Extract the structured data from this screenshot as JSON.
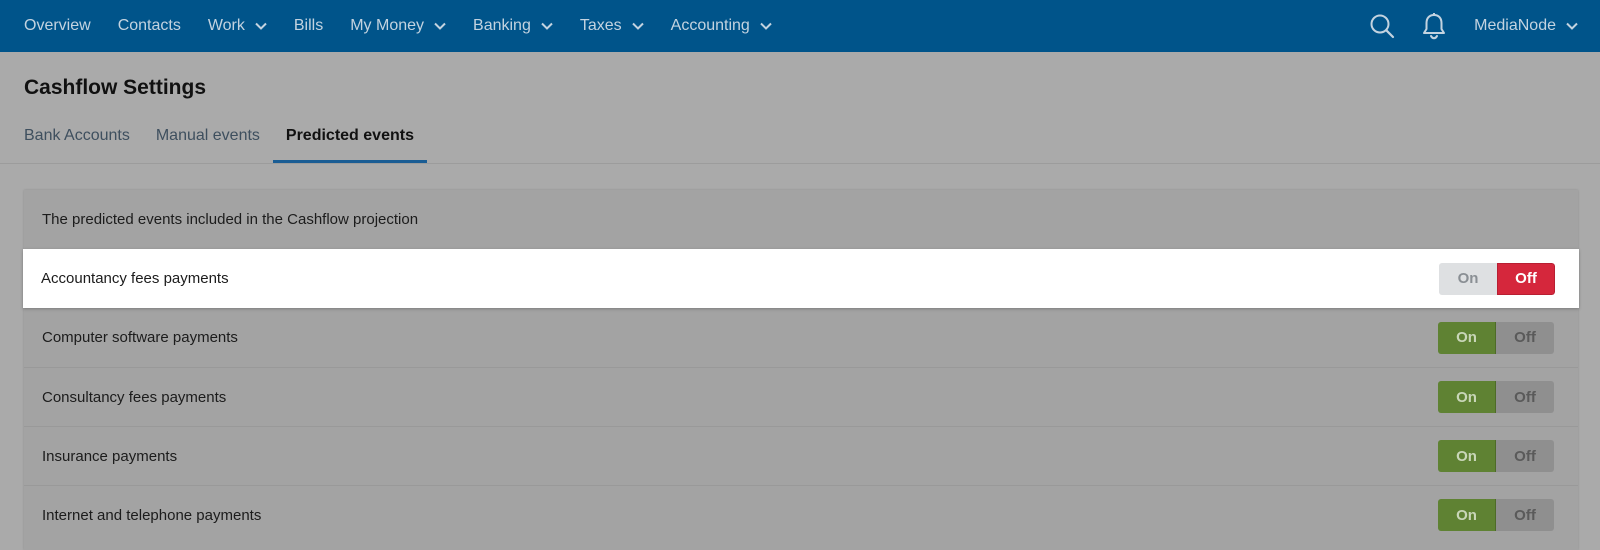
{
  "nav": {
    "items": [
      {
        "label": "Overview",
        "dropdown": false
      },
      {
        "label": "Contacts",
        "dropdown": false
      },
      {
        "label": "Work",
        "dropdown": true
      },
      {
        "label": "Bills",
        "dropdown": false
      },
      {
        "label": "My Money",
        "dropdown": true
      },
      {
        "label": "Banking",
        "dropdown": true
      },
      {
        "label": "Taxes",
        "dropdown": true
      },
      {
        "label": "Accounting",
        "dropdown": true
      }
    ],
    "account_label": "MediaNode",
    "icons": {
      "search": "search-icon",
      "notifications": "bell-icon"
    }
  },
  "page": {
    "title": "Cashflow Settings",
    "tabs": [
      {
        "label": "Bank Accounts",
        "active": false
      },
      {
        "label": "Manual events",
        "active": false
      },
      {
        "label": "Predicted events",
        "active": true
      }
    ]
  },
  "panel": {
    "header": "The predicted events included in the Cashflow projection",
    "toggle_labels": {
      "on": "On",
      "off": "Off"
    },
    "rows": [
      {
        "label": "Accountancy fees payments",
        "state": "off",
        "highlighted": true
      },
      {
        "label": "Computer software payments",
        "state": "on",
        "highlighted": false
      },
      {
        "label": "Consultancy fees payments",
        "state": "on",
        "highlighted": false
      },
      {
        "label": "Insurance payments",
        "state": "on",
        "highlighted": false
      },
      {
        "label": "Internet and telephone payments",
        "state": "on",
        "highlighted": false
      }
    ]
  },
  "colors": {
    "nav_bg": "#00548a",
    "on_active": "#5f8233",
    "off_active": "#d5273c",
    "tab_underline": "#1a5d94"
  }
}
